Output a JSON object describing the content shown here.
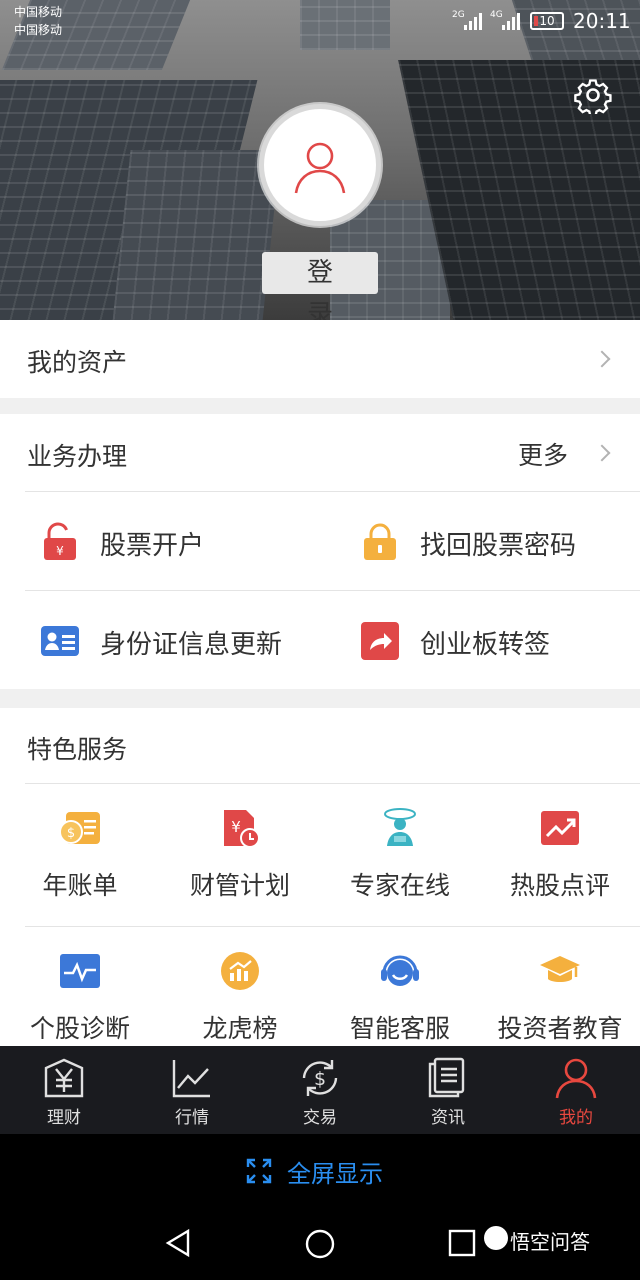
{
  "status_bar": {
    "carrier_1": "中国移动",
    "carrier_2": "中国移动",
    "network_1": "2G",
    "network_2": "4G",
    "battery": "10",
    "time": "20:11"
  },
  "header": {
    "settings_icon": "gear-icon",
    "avatar_icon": "user-icon",
    "login_label": "登 录"
  },
  "assets": {
    "label": "我的资产"
  },
  "business": {
    "title": "业务办理",
    "more_label": "更多",
    "items": [
      {
        "label": "股票开户",
        "icon": "unlock-yuan-icon",
        "color": "#e04848"
      },
      {
        "label": "找回股票密码",
        "icon": "lock-icon",
        "color": "#f4b03e"
      },
      {
        "label": "身份证信息更新",
        "icon": "id-card-icon",
        "color": "#3c78d8"
      },
      {
        "label": "创业板转签",
        "icon": "share-arrow-icon",
        "color": "#e04848"
      }
    ]
  },
  "features": {
    "title": "特色服务",
    "items": [
      {
        "label": "年账单",
        "icon": "bill-scroll-icon",
        "color": "#f4b03e"
      },
      {
        "label": "财管计划",
        "icon": "finance-plan-icon",
        "color": "#e04848"
      },
      {
        "label": "专家在线",
        "icon": "expert-icon",
        "color": "#3bb3c3"
      },
      {
        "label": "热股点评",
        "icon": "hot-stock-icon",
        "color": "#e04848"
      },
      {
        "label": "个股诊断",
        "icon": "pulse-icon",
        "color": "#3c78d8"
      },
      {
        "label": "龙虎榜",
        "icon": "ranking-icon",
        "color": "#f4b03e"
      },
      {
        "label": "智能客服",
        "icon": "headset-icon",
        "color": "#3c78d8"
      },
      {
        "label": "投资者教育",
        "icon": "graduation-cap-icon",
        "color": "#f4b03e"
      }
    ]
  },
  "tabbar": {
    "items": [
      {
        "label": "理财",
        "icon": "yuan-icon"
      },
      {
        "label": "行情",
        "icon": "chart-icon"
      },
      {
        "label": "交易",
        "icon": "dollar-exchange-icon"
      },
      {
        "label": "资讯",
        "icon": "document-icon"
      },
      {
        "label": "我的",
        "icon": "user-icon",
        "active": true
      }
    ],
    "active_color": "#e8483f"
  },
  "fullscreen": {
    "label": "全屏显示",
    "icon": "expand-icon",
    "color": "#2a8ef0"
  },
  "navbar": {
    "watermark": "悟空问答"
  }
}
